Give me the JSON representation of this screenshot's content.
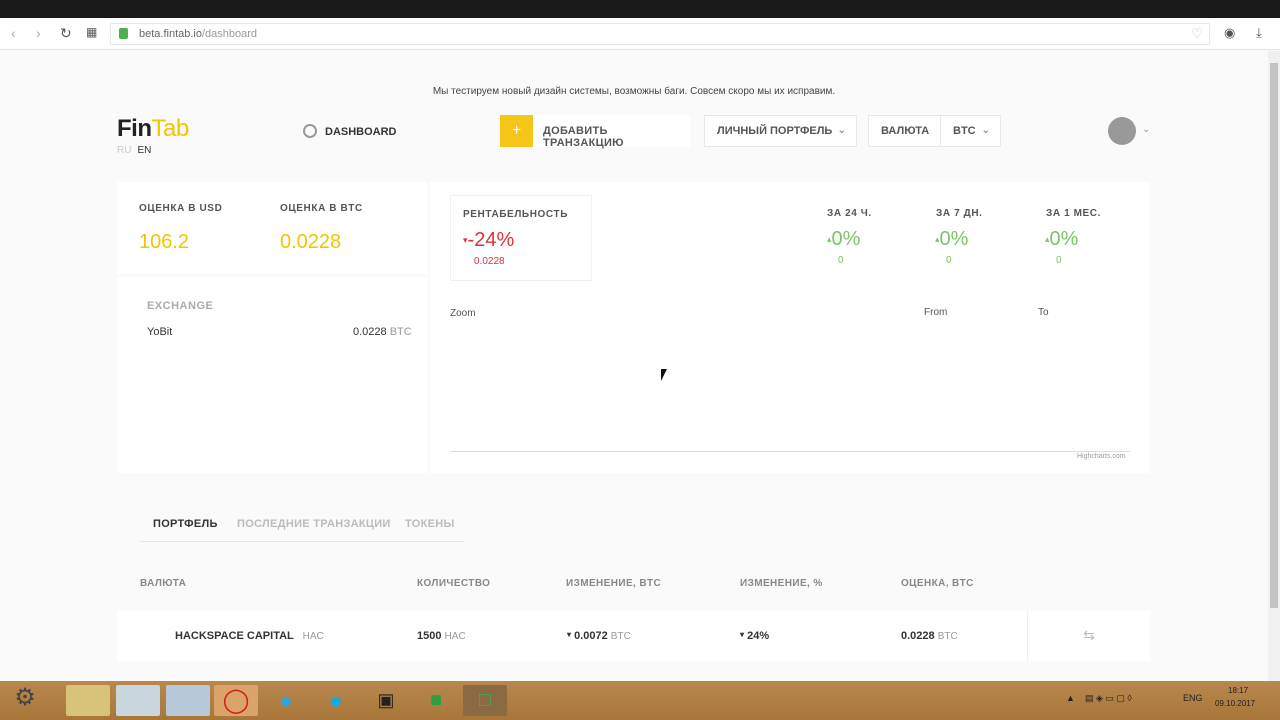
{
  "browser": {
    "url_host": "beta.fintab.io",
    "url_path": "/dashboard",
    "back_icon": "back-arrow-icon",
    "forward_icon": "forward-arrow-icon",
    "reload_icon": "reload-icon",
    "grid_icon": "grid-icon"
  },
  "notice": "Мы тестируем новый дизайн системы, возможны баги. Совсем скоро мы их исправим.",
  "header": {
    "logo_fin": "Fin",
    "logo_tab": "Tab",
    "lang_ru": "RU",
    "lang_en": "EN",
    "dashboard_label": "DASHBOARD",
    "add_plus": "+",
    "add_label": "ДОБАВИТЬ ТРАНЗАКЦИЮ",
    "portfolio_label": "ЛИЧНЫЙ ПОРТФЕЛЬ",
    "currency_label": "ВАЛЮТА",
    "currency_value": "BTC"
  },
  "summary": {
    "usd_label": "ОЦЕНКА В USD",
    "usd_value": "106.2",
    "btc_label": "ОЦЕНКА В BTC",
    "btc_value": "0.0228"
  },
  "exchange": {
    "title": "EXCHANGE",
    "name": "YoBit",
    "amount": "0.0228",
    "unit": "BTC"
  },
  "profitability": {
    "label": "РЕНТАБЕЛЬНОСТЬ",
    "arrow": "▾",
    "percent": "-24%",
    "value": "0.0228"
  },
  "periods": [
    {
      "label": "ЗА 24 Ч.",
      "arrow": "▴",
      "percent": "0%",
      "value": "0"
    },
    {
      "label": "ЗА 7 ДН.",
      "arrow": "▴",
      "percent": "0%",
      "value": "0"
    },
    {
      "label": "ЗА 1 МЕС.",
      "arrow": "▴",
      "percent": "0%",
      "value": "0"
    }
  ],
  "chart": {
    "zoom": "Zoom",
    "from": "From",
    "to": "To",
    "credit": "Highcharts.com"
  },
  "tabs": {
    "portfolio": "ПОРТФЕЛЬ",
    "transactions": "ПОСЛЕДНИЕ ТРАНЗАКЦИИ",
    "tokens": "ТОКЕНЫ"
  },
  "table": {
    "headers": [
      "ВАЛЮТА",
      "КОЛИЧЕСТВО",
      "ИЗМЕНЕНИЕ, BTC",
      "ИЗМЕНЕНИЕ, %",
      "ОЦЕНКА, BTC"
    ],
    "rows": [
      {
        "name": "HACKSPACE CAPITAL",
        "ticker": "HAC",
        "quantity": "1500",
        "quantity_unit": "HAC",
        "change_btc": "0.0072",
        "change_btc_unit": "BTC",
        "change_pct": "24%",
        "estimate": "0.0228",
        "estimate_unit": "BTC"
      }
    ]
  },
  "taskbar": {
    "lang": "ENG",
    "time": "18:17",
    "date": "09.10.2017"
  },
  "colors": {
    "accent": "#f5c518",
    "negative": "#e0313b",
    "positive": "#7cc36a"
  }
}
